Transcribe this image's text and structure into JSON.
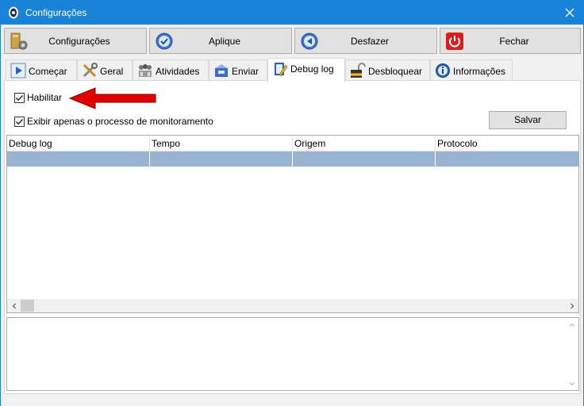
{
  "window": {
    "title": "Configurações",
    "accent_color": "#1883d7",
    "app_icon": "monitor-eye-icon",
    "close_icon": "close-icon"
  },
  "toolbar": [
    {
      "label": "Configurações",
      "icon": "folder-gear-icon"
    },
    {
      "label": "Aplique",
      "icon": "check-circle-icon"
    },
    {
      "label": "Desfazer",
      "icon": "undo-circle-icon"
    },
    {
      "label": "Fechar",
      "icon": "power-icon"
    }
  ],
  "tabs": [
    {
      "label": "Começar",
      "icon": "play-icon",
      "active": false
    },
    {
      "label": "Geral",
      "icon": "tools-icon",
      "active": false
    },
    {
      "label": "Atividades",
      "icon": "users-icon",
      "active": false
    },
    {
      "label": "Enviar",
      "icon": "send-box-icon",
      "active": false
    },
    {
      "label": "Debug log",
      "icon": "notepad-pencil-icon",
      "active": true
    },
    {
      "label": "Desbloquear",
      "icon": "unlock-icon",
      "active": false
    },
    {
      "label": "Informações",
      "icon": "info-icon",
      "active": false
    }
  ],
  "debug_log": {
    "enable_label": "Habilitar",
    "enable_checked": true,
    "monitor_only_label": "Exibir apenas o processo de monitoramento",
    "monitor_only_checked": true,
    "save_label": "Salvar",
    "columns": [
      "Debug log",
      "Tempo",
      "Origem",
      "Protocolo"
    ],
    "selected_row_color": "#99b4d1"
  },
  "annotation": {
    "arrow_color": "#e00000"
  }
}
